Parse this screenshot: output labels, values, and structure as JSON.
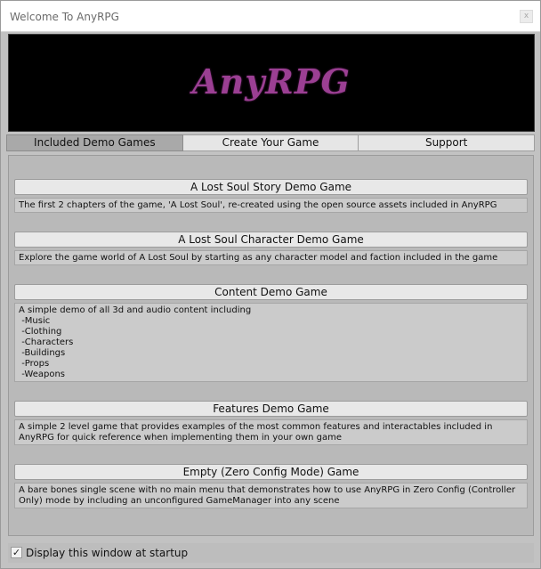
{
  "window": {
    "title": "Welcome To AnyRPG",
    "close_glyph": "x"
  },
  "banner": {
    "logo_text": "AnyRPG",
    "logo_color": "#9b3f93"
  },
  "tabs": [
    {
      "label": "Included Demo Games",
      "active": true
    },
    {
      "label": "Create Your Game",
      "active": false
    },
    {
      "label": "Support",
      "active": false
    }
  ],
  "games": [
    {
      "title": "A Lost Soul Story Demo Game",
      "description": "The first 2 chapters of the game, 'A Lost Soul', re-created using the open source assets included in AnyRPG"
    },
    {
      "title": "A Lost Soul Character Demo Game",
      "description": "Explore the game world of A Lost Soul by starting as any character model and faction included in the game"
    },
    {
      "title": "Content Demo Game",
      "description": "A simple demo of all 3d and audio content including\n -Music\n -Clothing\n -Characters\n -Buildings\n -Props\n -Weapons"
    },
    {
      "title": "Features Demo Game",
      "description": "A simple 2 level game that provides examples of the most common features and interactables included in AnyRPG for quick reference when implementing them in your own game"
    },
    {
      "title": "Empty (Zero Config Mode) Game",
      "description": "A bare bones single scene with no main menu that demonstrates how to use AnyRPG in Zero Config (Controller Only) mode by including an unconfigured GameManager into any scene"
    }
  ],
  "footer": {
    "startup_checkbox_checked": true,
    "startup_label": "Display this window at startup",
    "check_glyph": "✓"
  }
}
